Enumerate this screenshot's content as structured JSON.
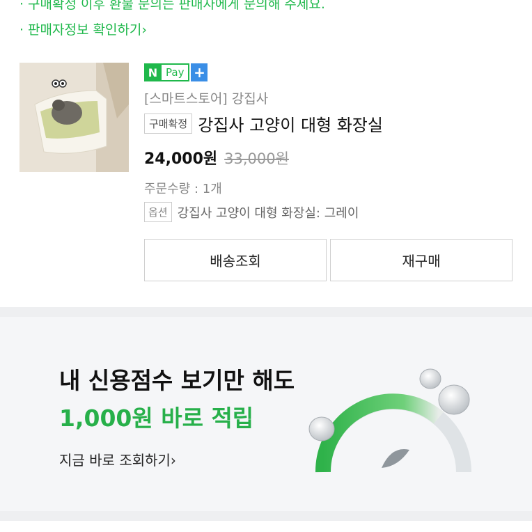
{
  "notice": {
    "line1": "구매확정 이후 환불 문의는 판매자에게 문의해 주세요.",
    "line2": "판매자정보 확인하기",
    "line2_arrow": "›"
  },
  "order": {
    "npay": {
      "n": "N",
      "pay": "Pay",
      "plus": "+"
    },
    "store": "[스마트스토어] 강집사",
    "status_tag": "구매확정",
    "title": "강집사 고양이 대형 화장실",
    "price": "24,000원",
    "original_price": "33,000원",
    "quantity": "주문수량 : 1개",
    "option_tag": "옵션",
    "option": "강집사 고양이 대형 화장실: 그레이",
    "buttons": {
      "shipping": "배송조회",
      "rebuy": "재구매"
    }
  },
  "banner": {
    "line1": "내 신용점수 보기만 해도",
    "line2": "1,000원 바로 적립",
    "link": "지금 바로 조회하기",
    "link_arrow": "›"
  },
  "colors": {
    "brand_green": "#1fb84b",
    "npay_plus_blue": "#3a8ee6",
    "banner_bg": "#f5f6f8"
  },
  "icons": [
    "npay-logo-icon",
    "product-thumbnail",
    "credit-gauge-icon"
  ]
}
